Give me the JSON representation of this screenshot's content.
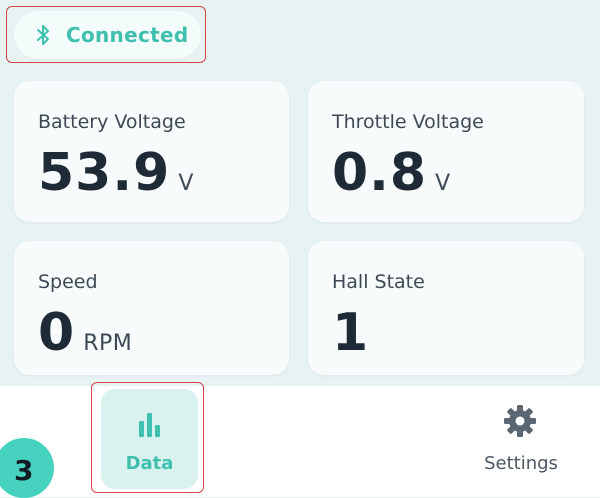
{
  "status": {
    "label": "Connected",
    "icon": "bluetooth-icon",
    "color": "#3fbfae"
  },
  "cards": [
    {
      "title": "Battery Voltage",
      "value": "53.9",
      "unit": "V"
    },
    {
      "title": "Throttle Voltage",
      "value": "0.8",
      "unit": "V"
    },
    {
      "title": "Speed",
      "value": "0",
      "unit": "RPM"
    },
    {
      "title": "Hall State",
      "value": "1",
      "unit": ""
    }
  ],
  "nav": {
    "data": {
      "label": "Data",
      "icon": "bar-chart-icon",
      "active": true
    },
    "settings": {
      "label": "Settings",
      "icon": "gear-icon"
    }
  },
  "step_badge": "3",
  "colors": {
    "accent": "#3fbfae",
    "highlight": "#d64545",
    "badge": "#46d2bf"
  }
}
